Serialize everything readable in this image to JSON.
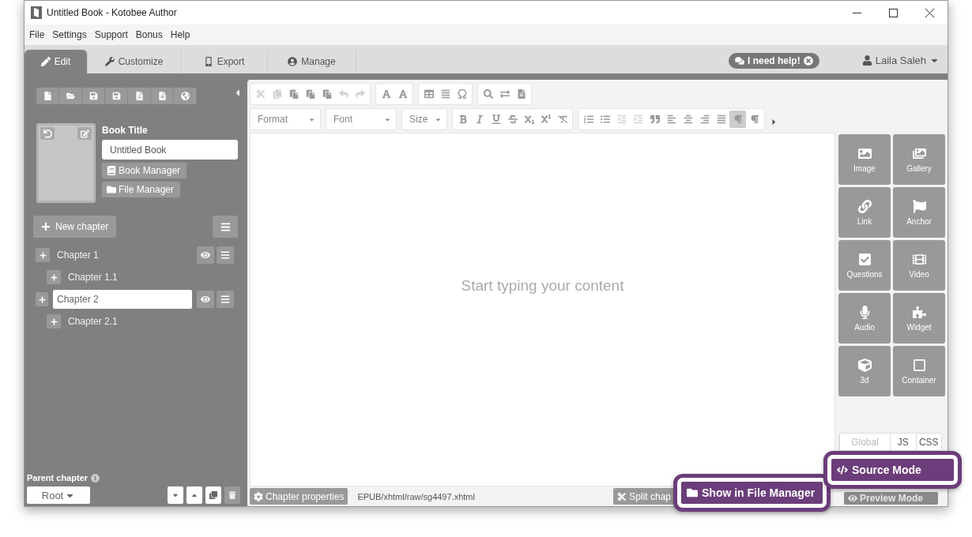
{
  "window": {
    "title": "Untitled Book - Kotobee Author"
  },
  "menu": [
    "File",
    "Settings",
    "Support",
    "Bonus",
    "Help"
  ],
  "tabs": [
    {
      "label": "Edit",
      "selected": true
    },
    {
      "label": "Customize",
      "selected": false
    },
    {
      "label": "Export",
      "selected": false
    },
    {
      "label": "Manage",
      "selected": false
    }
  ],
  "help_button": "I need help!",
  "user": "Laila Saleh",
  "sidebar": {
    "book_title_label": "Book Title",
    "book_title_value": "Untitled Book",
    "buttons": [
      "Book Manager",
      "File Manager"
    ],
    "new_chapter": "New chapter",
    "chapters": [
      {
        "title": "Chapter 1",
        "editing": false,
        "children": [
          {
            "title": "Chapter 1.1",
            "editing": false
          }
        ]
      },
      {
        "title": "Chapter 2",
        "editing": true,
        "children": [
          {
            "title": "Chapter 2.1",
            "editing": false
          }
        ]
      }
    ],
    "parent_chapter_label": "Parent chapter",
    "parent_chapter_value": "Root"
  },
  "toolbar": {
    "row_1": [
      [
        {
          "disabled": true
        },
        {
          "disabled": true
        },
        {
          "disabled": false
        },
        {
          "disabled": false
        },
        {
          "disabled": false
        },
        {
          "disabled": true
        },
        {
          "disabled": true
        }
      ],
      [
        {
          "disabled": false
        },
        {
          "disabled": false
        }
      ],
      [
        {
          "disabled": false
        },
        {
          "disabled": false
        },
        {
          "disabled": false
        }
      ],
      [
        {
          "disabled": false
        },
        {
          "disabled": false
        },
        {
          "disabled": false
        }
      ]
    ],
    "dropdowns": [
      "Format",
      "Font",
      "Size"
    ],
    "row_2": [
      [
        {
          "selected": false
        },
        {
          "selected": false
        },
        {
          "selected": false
        },
        {
          "selected": false
        },
        {
          "selected": false
        },
        {
          "selected": false
        },
        {
          "selected": false
        }
      ],
      [
        {
          "selected": false
        },
        {
          "selected": false
        },
        {
          "selected": false
        },
        {
          "selected": false
        },
        {
          "selected": false
        },
        {
          "selected": false
        },
        {
          "selected": false
        },
        {
          "selected": false
        },
        {
          "selected": false
        },
        {
          "selected": true
        },
        {
          "selected": false
        }
      ]
    ]
  },
  "editor": {
    "placeholder": "Start typing your content"
  },
  "widgets": [
    "Image",
    "Gallery",
    "Link",
    "Anchor",
    "Questions",
    "Video",
    "Audio",
    "Widget",
    "3d",
    "Container"
  ],
  "script_tabs": [
    {
      "label": "Global",
      "disabled": true
    },
    {
      "label": "JS",
      "disabled": false
    },
    {
      "label": "CSS",
      "disabled": false
    }
  ],
  "status_bar": {
    "chapter_properties": "Chapter properties",
    "path": "EPUB/xhtml/raw/sg4497.xhtml",
    "split": "Split chap",
    "preview": "Preview Mode"
  },
  "callouts": [
    "Show in File Manager",
    "Source Mode"
  ]
}
